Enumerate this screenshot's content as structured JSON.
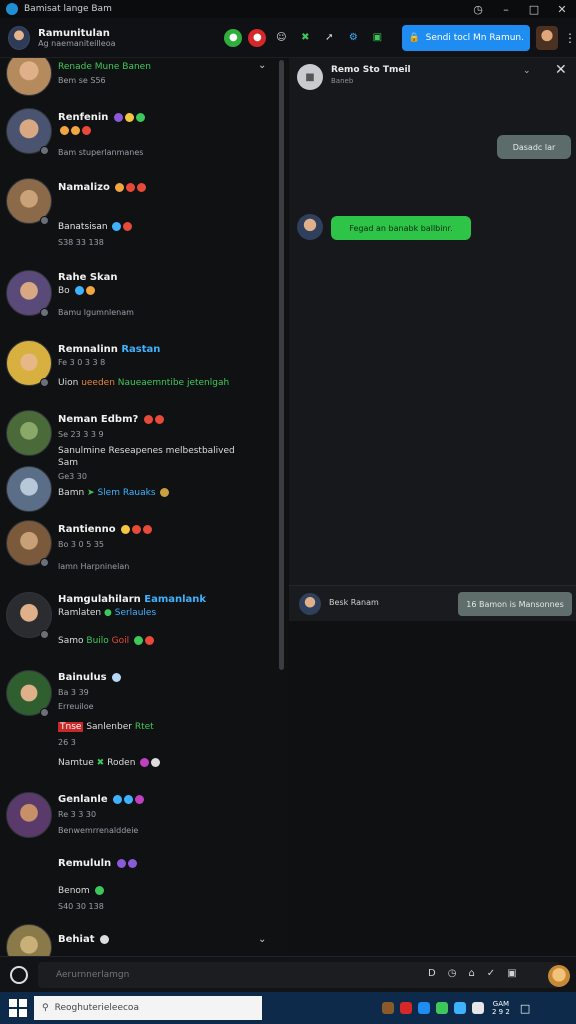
{
  "window": {
    "title": "Bamisat lange Bam",
    "controls": [
      "history-icon",
      "minimize-icon",
      "maximize-icon",
      "close-icon"
    ]
  },
  "header": {
    "name": "Ramunitulan",
    "subtitle": "Ag naemaniteilleoa",
    "primary_button": "Sendi tocl Mn Ramun.",
    "icons": [
      "green-logo-icon",
      "red-badge-icon",
      "smiley-icon",
      "x-logo-icon",
      "wrench-icon",
      "gear-icon",
      "green-chat-icon"
    ]
  },
  "conversations": [
    {
      "name": "Renade Mune Banen",
      "lines": [
        "Bem se S56"
      ],
      "name_color": "#3ec85b",
      "avatar_color": "#b58a5c"
    },
    {
      "name": "Renfenin",
      "lines": [
        "Bam stuperlanmanes"
      ],
      "avatar_color": "#4a5470"
    },
    {
      "name": "Namalizo",
      "lines": [
        "Banatsisan",
        "S38 33 138"
      ],
      "avatar_color": "#8a6a48"
    },
    {
      "name": "Rahe Skan",
      "lines": [
        "Bo",
        "Bamu lgumnlenam"
      ],
      "avatar_color": "#5a4a7a"
    },
    {
      "name": "Remnalinn",
      "name_suffix": "Rastan",
      "lines": [
        "Fe 3 0 3 3 8",
        "Uion",
        "ueeden",
        "Naueaemntibe jetenlgah"
      ],
      "avatar_color": "#d8b040"
    },
    {
      "name": "Neman Edbm?",
      "lines": [
        "Se 23 3 3 9",
        "Sanulmine Reseapenes melbestbalived",
        "Sam"
      ],
      "avatar_color": "#4a6a3a"
    },
    {
      "name": "Bamn",
      "lines": [
        "Ge3 30",
        "Slem Rauaks"
      ],
      "avatar_color": "#5a6e88"
    },
    {
      "name": "Rantienno",
      "lines": [
        "Bo 3 0 5 35",
        "lamn Harpninelan"
      ],
      "avatar_color": "#7a5a3a"
    },
    {
      "name": "Hamgulahilarn",
      "name_suffix": "Eamanlank",
      "lines": [
        "Ramlaten",
        "Serlaules",
        "Samo",
        "Builo",
        "Goil"
      ],
      "avatar_color": "#2a2c30"
    },
    {
      "name": "Bainulus",
      "lines": [
        "Ba 3 39",
        "Erreuiloe",
        "Tnse",
        "Sanlenber",
        "Rtet",
        "26 3",
        "Namtue",
        "Roden"
      ],
      "avatar_color": "#2f5e2f"
    },
    {
      "name": "Genlanle",
      "lines": [
        "Re 3 3 30",
        "Benwemrrenalddeie"
      ],
      "avatar_color": "#5a3a6a"
    },
    {
      "name": "Remululn",
      "lines": [
        "Benom",
        "S40 30 138"
      ],
      "avatar_color": "#3a3c44"
    },
    {
      "name": "Behiat",
      "lines": [],
      "avatar_color": "#8a7a4a"
    }
  ],
  "chat_panel": {
    "title": "Remo Sto Tmeil",
    "subtitle": "Baneb",
    "outgoing_message": "Dasadc lar",
    "incoming_message": "Fegad an banabk ballbinr.",
    "footer_name": "Besk Ranam",
    "footer_button": "16 Bamon is Mansonnes"
  },
  "bottom_bar": {
    "search_placeholder": "Aerurnnerlamgn",
    "icons": [
      "d-icon",
      "clock-icon",
      "home-icon",
      "check-icon",
      "calendar-icon"
    ]
  },
  "taskbar": {
    "search_text": "Reoghuterieleecoa",
    "time": "GAM",
    "date": "2 9 2"
  }
}
